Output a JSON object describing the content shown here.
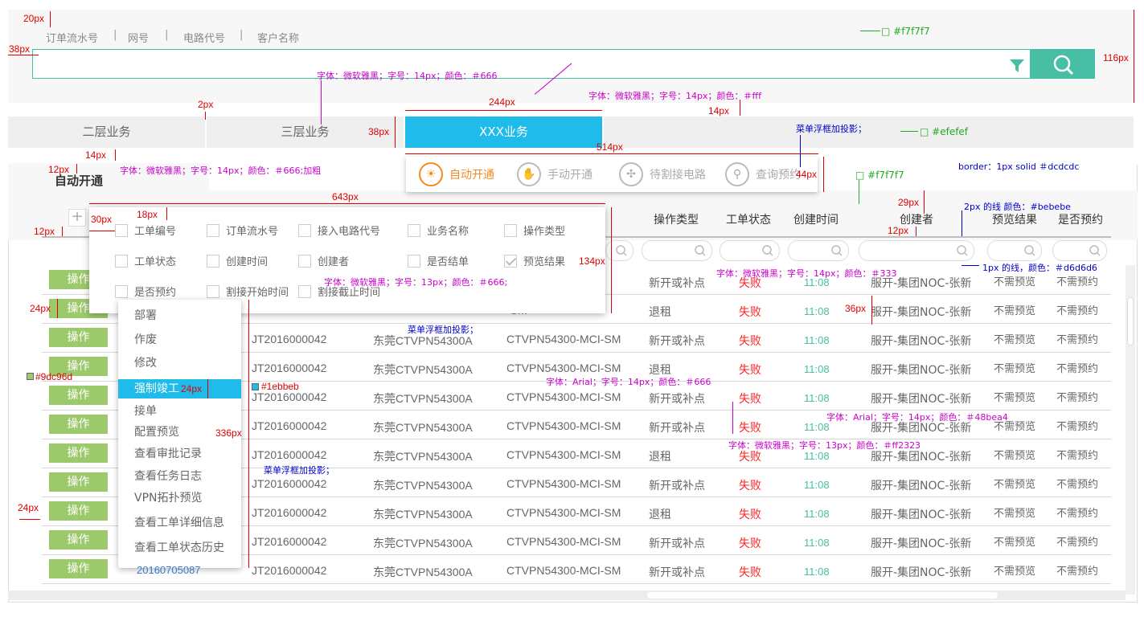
{
  "search": {
    "field_tabs": [
      "订单流水号",
      "网号",
      "电路代号",
      "客户名称"
    ],
    "separator": "|"
  },
  "tabs": {
    "items": [
      "二层业务",
      "三层业务"
    ],
    "active": "XXX业务"
  },
  "biz_menu": {
    "items": [
      {
        "label": "自动开通",
        "icon": "lightbulb-icon",
        "active": true
      },
      {
        "label": "手动开通",
        "icon": "hand-icon",
        "active": false
      },
      {
        "label": "待割接电路",
        "icon": "circuit-icon",
        "active": false
      },
      {
        "label": "查询预约",
        "icon": "search-icon",
        "active": false
      }
    ]
  },
  "panel": {
    "title": "自动开通",
    "plus": "+"
  },
  "columns": {
    "headers": [
      "操作类型",
      "工单状态",
      "创建时间",
      "创建者",
      "预览结果",
      "是否预约"
    ]
  },
  "col_picker": {
    "items": [
      {
        "label": "工单编号",
        "checked": false
      },
      {
        "label": "订单流水号",
        "checked": false
      },
      {
        "label": "接入电路代号",
        "checked": false
      },
      {
        "label": "业务名称",
        "checked": false
      },
      {
        "label": "操作类型",
        "checked": false
      },
      {
        "label": "工单状态",
        "checked": false
      },
      {
        "label": "创建时间",
        "checked": false
      },
      {
        "label": "创建者",
        "checked": false
      },
      {
        "label": "是否结单",
        "checked": false
      },
      {
        "label": "预览结果",
        "checked": true
      },
      {
        "label": "是否预约",
        "checked": false
      },
      {
        "label": "割接开始时间",
        "checked": false
      },
      {
        "label": "割接截止时间",
        "checked": false
      }
    ]
  },
  "ctx_menu": {
    "items": [
      "部署",
      "作废",
      "修改",
      "强制竣工",
      "接单",
      "配置预览",
      "查看审批记录",
      "查看任务日志",
      "VPN拓扑预览",
      "查看工单详细信息",
      "查看工单状态历史"
    ],
    "highlighted_index": 3
  },
  "table": {
    "op_label": "操作",
    "partial_order": "20160705087",
    "rows": [
      {
        "order": "",
        "dg": "",
        "circuit": "-SM",
        "type": "新开或补点",
        "status": "失败",
        "time": "11:08",
        "creator": "服开-集团NOC-张新",
        "preview": "不需预览",
        "reserve": "不需预约"
      },
      {
        "order": "",
        "dg": "",
        "circuit": "-SM",
        "type": "退租",
        "status": "失败",
        "time": "11:08",
        "creator": "服开-集团NOC-张新",
        "preview": "不需预览",
        "reserve": "不需预约"
      },
      {
        "order": "JT2016000042",
        "dg": "东莞CTVPN54300A",
        "circuit": "CTVPN54300-MCI-SM",
        "type": "新开或补点",
        "status": "失败",
        "time": "11:08",
        "creator": "服开-集团NOC-张新",
        "preview": "不需预览",
        "reserve": "不需预约"
      },
      {
        "order": "JT2016000042",
        "dg": "东莞CTVPN54300A",
        "circuit": "CTVPN54300-MCI-SM",
        "type": "退租",
        "status": "失败",
        "time": "11:08",
        "creator": "服开-集团NOC-张新",
        "preview": "不需预览",
        "reserve": "不需预约"
      },
      {
        "order": "JT2016000042",
        "dg": "东莞CTVPN54300A",
        "circuit": "CTVPN54300-MCI-SM",
        "type": "新开或补点",
        "status": "失败",
        "time": "11:08",
        "creator": "服开-集团NOC-张新",
        "preview": "不需预览",
        "reserve": "不需预约"
      },
      {
        "order": "JT2016000042",
        "dg": "东莞CTVPN54300A",
        "circuit": "CTVPN54300-MCI-SM",
        "type": "新开或补点",
        "status": "失败",
        "time": "11:08",
        "creator": "服开-集团NOC-张新",
        "preview": "不需预览",
        "reserve": "不需预约"
      },
      {
        "order": "JT2016000042",
        "dg": "东莞CTVPN54300A",
        "circuit": "CTVPN54300-MCI-SM",
        "type": "退租",
        "status": "失败",
        "time": "11:08",
        "creator": "服开-集团NOC-张新",
        "preview": "不需预览",
        "reserve": "不需预约"
      },
      {
        "order": "JT2016000042",
        "dg": "东莞CTVPN54300A",
        "circuit": "CTVPN54300-MCI-SM",
        "type": "新开或补点",
        "status": "失败",
        "time": "11:08",
        "creator": "服开-集团NOC-张新",
        "preview": "不需预览",
        "reserve": "不需预约"
      },
      {
        "order": "JT2016000042",
        "dg": "东莞CTVPN54300A",
        "circuit": "CTVPN54300-MCI-SM",
        "type": "退租",
        "status": "失败",
        "time": "11:08",
        "creator": "服开-集团NOC-张新",
        "preview": "不需预览",
        "reserve": "不需预约"
      },
      {
        "order": "JT2016000042",
        "dg": "东莞CTVPN54300A",
        "circuit": "CTVPN54300-MCI-SM",
        "type": "新开或补点",
        "status": "失败",
        "time": "11:08",
        "creator": "服开-集团NOC-张新",
        "preview": "不需预览",
        "reserve": "不需预约"
      },
      {
        "order": "JT2016000042",
        "dg": "东莞CTVPN54300A",
        "circuit": "CTVPN54300-MCI-SM",
        "type": "新开或补点",
        "status": "失败",
        "time": "11:08",
        "creator": "服开-集团NOC-张新",
        "preview": "不需预览",
        "reserve": "不需预约"
      }
    ]
  },
  "annotations": {
    "red": [
      "20px",
      "38px",
      "116px",
      "2px",
      "244px",
      "14px",
      "38px",
      "514px",
      "44px",
      "14px",
      "12px",
      "643px",
      "18px",
      "30px",
      "12px",
      "29px",
      "12px",
      "134px",
      "24px",
      "36px",
      "24px",
      "336px",
      "24px"
    ],
    "magenta": [
      "字体：微软雅黑；字号：14px；颜色：＃666",
      "字体：微软雅黑；字号：14px；颜色：＃fff",
      "字体：微软雅黑；字号：14px；颜色：＃666;加粗",
      "字体：微软雅黑；字号：14px；颜色：＃333",
      "字体：微软雅黑；字号：13px；颜色：＃666;",
      "字体：Arial；字号：14px；颜色：＃666",
      "字体：Arial；字号：14px；颜色：＃48bea4",
      "字体：微软雅黑；字号：13px；颜色：＃ff2323"
    ],
    "blue": [
      "菜单浮框加投影；",
      "border：1px solid ＃dcdcdc",
      "2px 的线 颜色：#bebebe",
      "1px 的线，颜色：＃d6d6d6",
      "菜单浮框加投影；",
      "菜单浮框加投影；"
    ],
    "green": [
      "#f7f7f7",
      "#efefef",
      "#f7f7f7"
    ],
    "swatches": [
      "#9dc96d",
      "#1ebbeb"
    ]
  }
}
